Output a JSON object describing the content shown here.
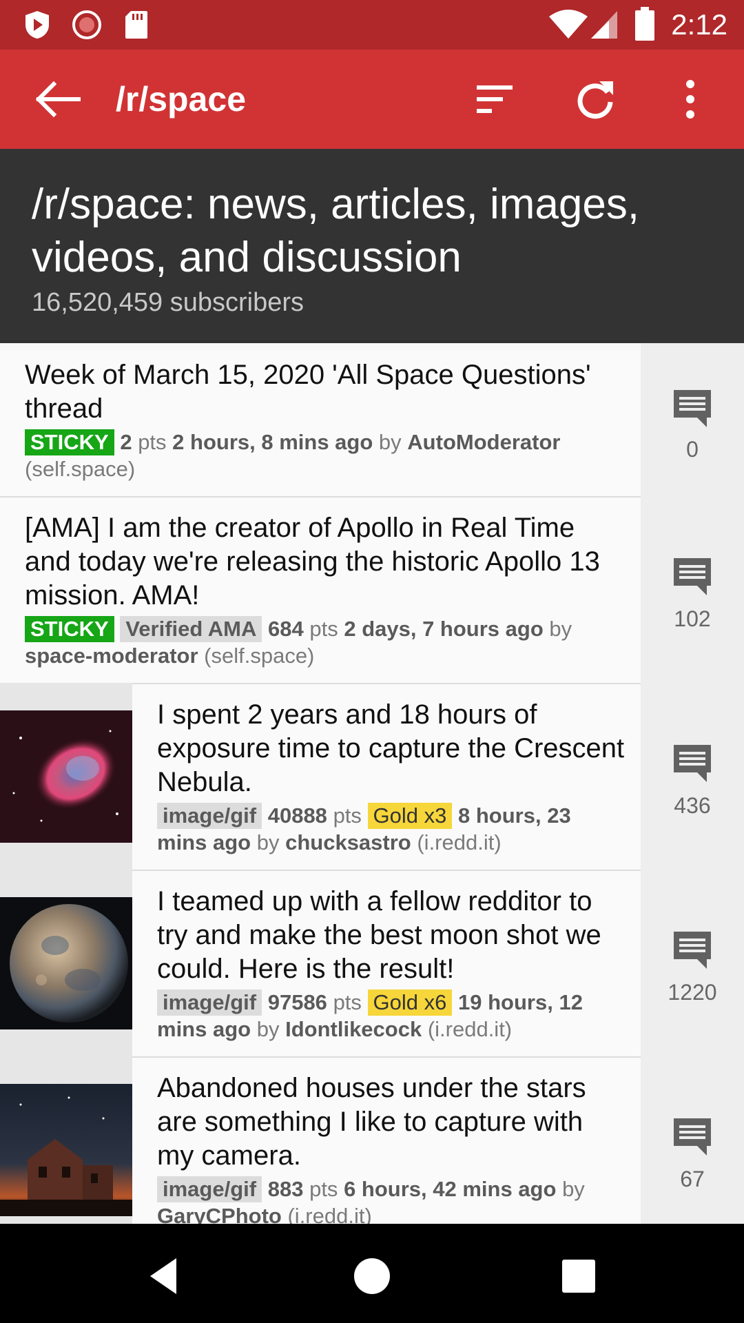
{
  "status_bar": {
    "time": "2:12"
  },
  "app_bar": {
    "title": "/r/space"
  },
  "subreddit": {
    "description": "/r/space: news, articles, images, videos, and discussion",
    "subscribers": "16,520,459 subscribers"
  },
  "posts": [
    {
      "title": "Week of March 15, 2020 'All Space Questions' thread",
      "sticky": "STICKY",
      "points": "2",
      "pts_label": "pts",
      "time": "2 hours, 8 mins ago",
      "by": "by",
      "author": "AutoModerator",
      "domain": "(self.space)",
      "comments": "0"
    },
    {
      "title": "[AMA] I am the creator of Apollo in Real Time and today we're releasing the historic Apollo 13 mission. AMA!",
      "sticky": "STICKY",
      "flair": "Verified AMA",
      "points": "684",
      "pts_label": "pts",
      "time": "2 days, 7 hours ago",
      "by": "by",
      "author": "space-moderator",
      "domain": "(self.space)",
      "comments": "102"
    },
    {
      "title": "I spent 2 years and 18 hours of exposure time to capture the Crescent Nebula.",
      "type": "image/gif",
      "points": "40888",
      "pts_label": "pts",
      "gold": "Gold x3",
      "time": "8 hours, 23 mins ago",
      "by": "by",
      "author": "chucksastro",
      "domain": "(i.redd.it)",
      "comments": "436"
    },
    {
      "title": "I teamed up with a fellow redditor to try and make the best moon shot we could. Here is the result!",
      "type": "image/gif",
      "points": "97586",
      "pts_label": "pts",
      "gold": "Gold x6",
      "time": "19 hours, 12 mins ago",
      "by": "by",
      "author": "Idontlikecock",
      "domain": "(i.redd.it)",
      "comments": "1220"
    },
    {
      "title": "Abandoned houses under the stars are something I like to capture with my camera.",
      "type": "image/gif",
      "points": "883",
      "pts_label": "pts",
      "time": "6 hours, 42 mins ago",
      "by": "by",
      "author": "GaryCPhoto",
      "domain": "(i.redd.it)",
      "comments": "67"
    }
  ],
  "colors": {
    "status_bar": "#b0282a",
    "app_bar": "#d13335",
    "header": "#333333",
    "sticky": "#16a616",
    "gold": "#f6d63a"
  },
  "icons": {
    "app_bar": [
      "back-arrow-icon",
      "sort-icon",
      "refresh-icon",
      "overflow-menu-icon"
    ],
    "status_bar": [
      "shield-play-icon",
      "record-icon",
      "sd-card-icon",
      "wifi-icon",
      "signal-icon",
      "battery-icon"
    ],
    "post": "comment-icon",
    "nav": [
      "back-triangle-icon",
      "home-circle-icon",
      "recents-square-icon"
    ]
  }
}
